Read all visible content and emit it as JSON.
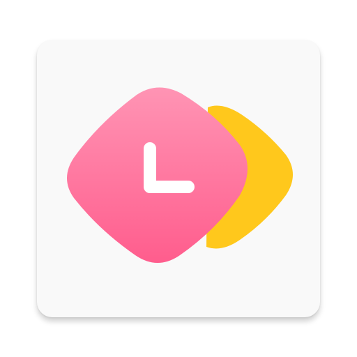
{
  "app_icon": {
    "name": "clock-app-icon",
    "colors": {
      "background": "#f9f9f9",
      "front_shape_top": "#ff8fb0",
      "front_shape_bottom": "#ff5c8c",
      "back_shape": "#ffc81c",
      "clock_hands": "#ffffff"
    }
  }
}
